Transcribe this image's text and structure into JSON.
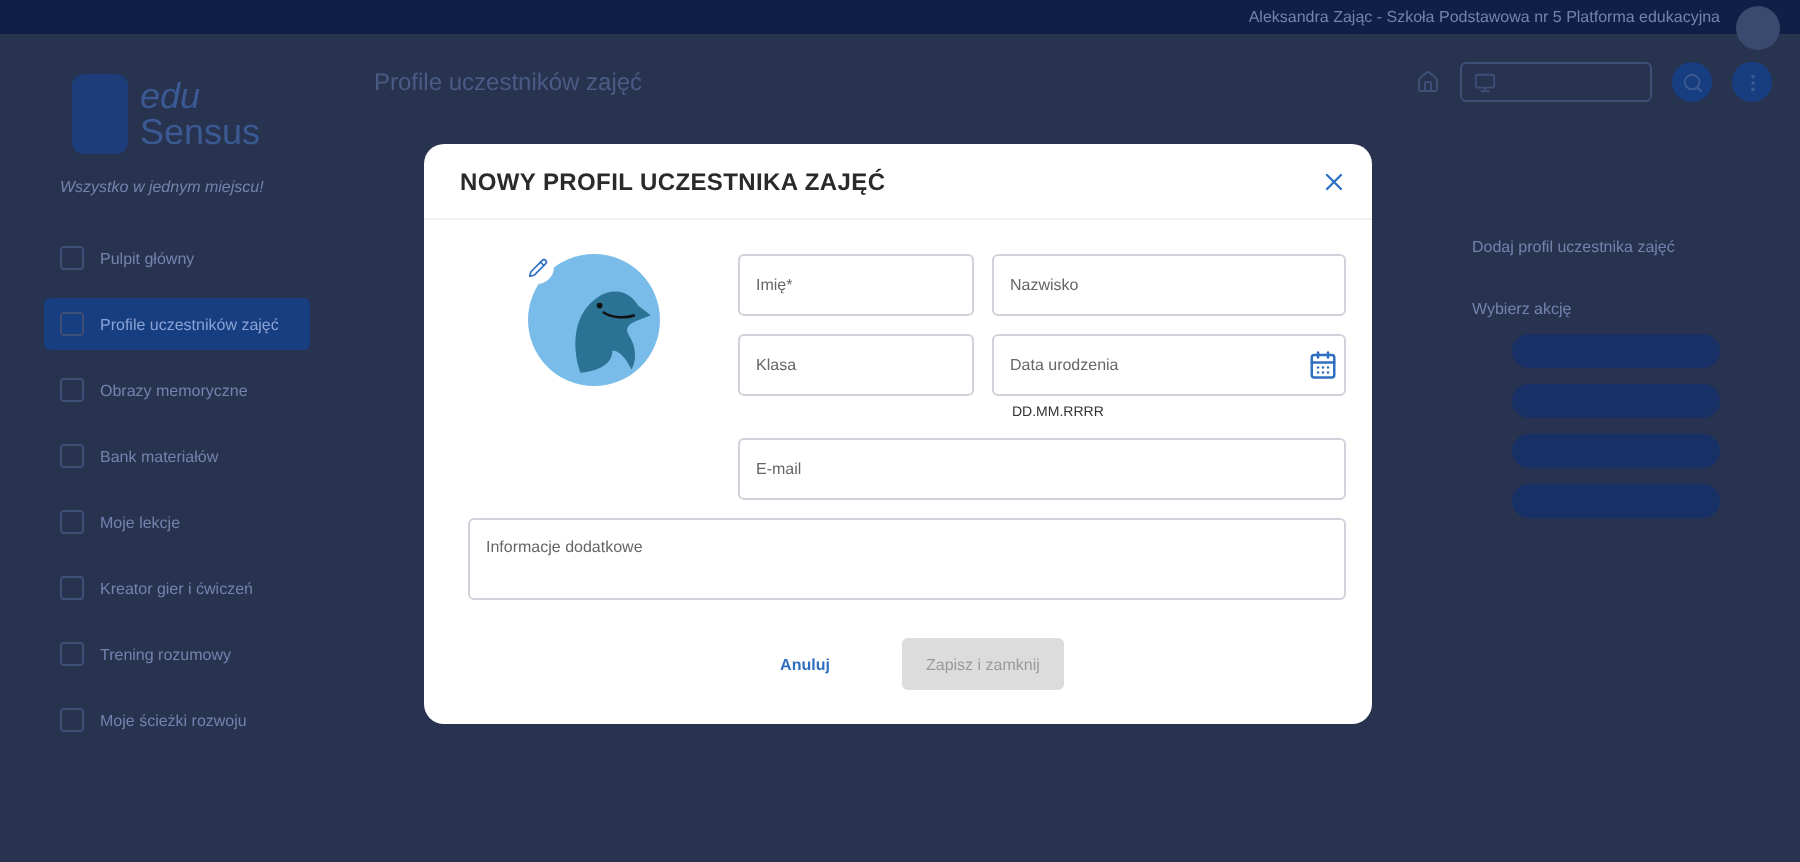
{
  "top_bar": {
    "user": "Aleksandra Zając - Szkoła Podstawowa nr 5 Platforma edukacyjna"
  },
  "sidebar": {
    "logo_top": "edu",
    "logo_bottom": "Sensus",
    "tagline": "Wszystko w jednym miejscu!",
    "items": [
      {
        "label": "Pulpit główny",
        "selected": false
      },
      {
        "label": "Profile uczestników zajęć",
        "selected": true
      },
      {
        "label": "Obrazy memoryczne",
        "selected": false
      },
      {
        "label": "Bank materiałów",
        "selected": false
      },
      {
        "label": "Moje lekcje",
        "selected": false
      },
      {
        "label": "Kreator gier i ćwiczeń",
        "selected": false
      },
      {
        "label": "Trening rozumowy",
        "selected": false
      },
      {
        "label": "Moje ścieżki rozwoju",
        "selected": false
      }
    ]
  },
  "main": {
    "title": "Profile uczestników zajęć",
    "add_profile": "Dodaj profil uczestnika zajęć",
    "actions_heading": "Wybierz akcję"
  },
  "dialog": {
    "title": "NOWY PROFIL UCZESTNIKA ZAJĘĆ",
    "first_name": {
      "placeholder": "Imię*"
    },
    "last_name": {
      "placeholder": "Nazwisko"
    },
    "class": {
      "placeholder": "Klasa"
    },
    "birth_date": {
      "placeholder": "Data urodzenia",
      "hint": "DD.MM.RRRR"
    },
    "email": {
      "placeholder": "E-mail"
    },
    "notes": {
      "placeholder": "Informacje dodatkowe"
    },
    "cancel": "Anuluj",
    "save": {
      "label": "Zapisz i zamknij",
      "disabled": true
    }
  }
}
